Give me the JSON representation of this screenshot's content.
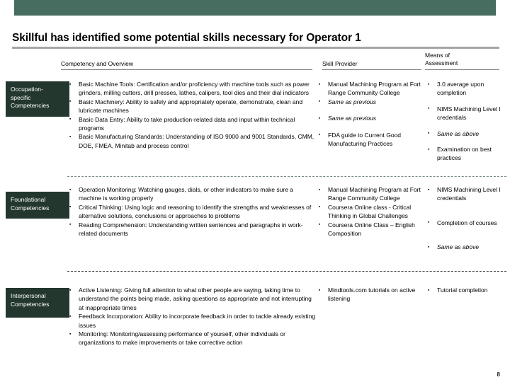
{
  "slide": {
    "title": "Skillful has identified some potential skills necessary for Operator 1",
    "page_number": "8",
    "accent_band_color": "#476c60",
    "category_box_color": "#23372e",
    "title_rule_color": "#a6a6a6"
  },
  "columns": {
    "competency": "Competency and Overview",
    "provider": "Skill Provider",
    "means": "Means of\nAssessment",
    "means_line1": "Means of",
    "means_line2": "Assessment"
  },
  "rows": [
    {
      "category_line1": "Occupation-",
      "category_line2": "specific",
      "category_line3": "Competencies",
      "competency": [
        {
          "text": "Basic Machine Tools: Certification and/or proficiency with machine tools such as power grinders, milling cutters, drill presses, lathes, calipers, tool dies and their dial indicators",
          "italic": false
        },
        {
          "text": "Basic Machinery: Ability to safely and appropriately operate, demonstrate, clean and lubricate machines",
          "italic": false
        },
        {
          "text": "Basic Data Entry: Ability to take production-related data and input within technical programs",
          "italic": false
        },
        {
          "text": "Basic Manufacturing Standards: Understanding of ISO 9000 and 9001 Standards, CMM, DOE, FMEA, Minitab and process control",
          "italic": false
        }
      ],
      "provider": [
        {
          "text": "Manual Machining Program at Fort Range Community College",
          "italic": false
        },
        {
          "text": "Same as previous",
          "italic": true
        },
        {
          "text": "Same as previous",
          "italic": true
        },
        {
          "text": "FDA guide to Current Good Manufacturing Practices",
          "italic": false
        }
      ],
      "means": [
        {
          "text": "3.0 average upon completion",
          "italic": false
        },
        {
          "text": "NIMS Machining Level I credentials",
          "italic": false
        },
        {
          "text": "Same as above",
          "italic": true
        },
        {
          "text": "Examination on best practices",
          "italic": false
        }
      ]
    },
    {
      "category_line1": "Foundational",
      "category_line2": "Competencies",
      "category_line3": "",
      "competency": [
        {
          "text": "Operation Monitoring: Watching gauges, dials, or other indicators to make sure a machine is working properly",
          "italic": false
        },
        {
          "text": "Critical Thinking: Using logic and reasoning to identify the strengths and weaknesses of alternative solutions, conclusions or approaches to problems",
          "italic": false
        },
        {
          "text": "Reading Comprehension: Understanding written sentences and paragraphs in work-related documents",
          "italic": false
        }
      ],
      "provider": [
        {
          "text": "Manual Machining Program at Fort Range Community College",
          "italic": false
        },
        {
          "text": "Coursera Online class - Critical Thinking in Global Challenges",
          "italic": false
        },
        {
          "text": "Coursera Online Class – English Composition",
          "italic": false
        }
      ],
      "means": [
        {
          "text": "NIMS Machining Level I credentials",
          "italic": false
        },
        {
          "text": "Completion of courses",
          "italic": false
        },
        {
          "text": "Same as above",
          "italic": true
        }
      ]
    },
    {
      "category_line1": "Interpersonal",
      "category_line2": "Competencies",
      "category_line3": "",
      "competency": [
        {
          "text": "Active Listening: Giving full attention to what other people are saying, taking time to understand the points being made, asking questions as appropriate and not interrupting at inappropriate times",
          "italic": false
        },
        {
          "text": "Feedback Incorporation: Ability to incorporate feedback in order to tackle already existing issues",
          "italic": false
        },
        {
          "text": "Monitoring: Monitoring/assessing performance of yourself, other individuals or organizations to make improvements or take corrective action",
          "italic": false
        }
      ],
      "provider": [
        {
          "text": "Mindtools.com tutorials on active listening",
          "italic": false
        }
      ],
      "means": [
        {
          "text": "Tutorial completion",
          "italic": false
        }
      ]
    }
  ]
}
